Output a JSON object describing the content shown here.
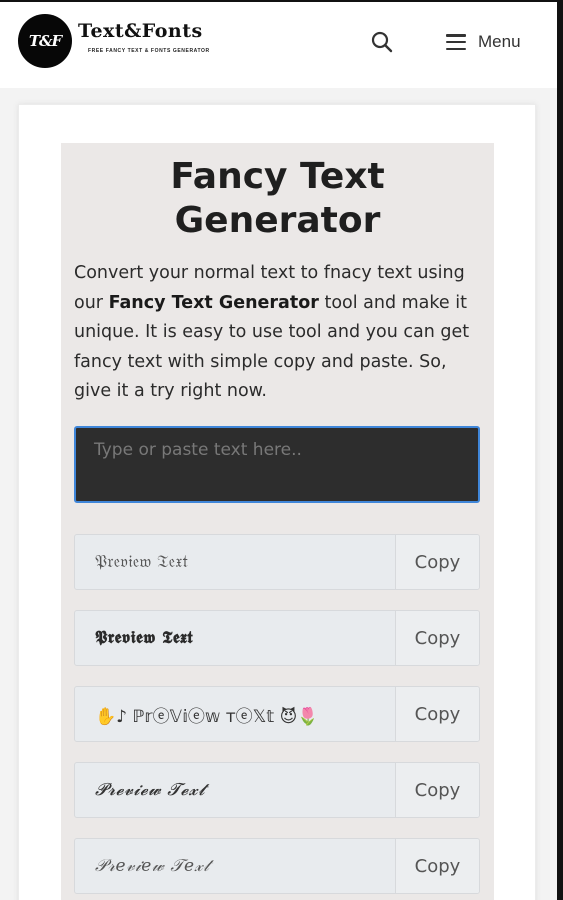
{
  "header": {
    "logo_text": "T&F",
    "brand_title": "Text&Fonts",
    "brand_tagline": "FREE FANCY TEXT & FONTS GENERATOR",
    "search_icon": "search-icon",
    "menu_icon": "hamburger-menu-icon",
    "menu_label": "Menu"
  },
  "main": {
    "title_line1": "Fancy Text",
    "title_line2": "Generator",
    "description": {
      "before": "Convert your normal text to fnacy text using our ",
      "bold": "Fancy Text Generator",
      "after": " tool and make it unique. It is easy to use tool and you can get fancy text with simple copy and paste. So, give it a try right now."
    },
    "input": {
      "placeholder": "Type or paste text here..",
      "value": ""
    },
    "results": [
      {
        "preview": "𝔓𝔯𝔢𝔳𝔦𝔢𝔴 𝔗𝔢𝔵𝔱",
        "copy_label": "Copy"
      },
      {
        "preview": "𝕻𝖗𝖊𝖛𝖎𝖊𝖜 𝕿𝖊𝖝𝖙",
        "copy_label": "Copy"
      },
      {
        "preview": "✋♪ ℙ𝕣ⓔ𝕍𝕚ⓔ𝕨 тⓔ𝕏𝕥 😈🌷",
        "copy_label": "Copy"
      },
      {
        "preview": "𝓟𝓻𝓮𝓿𝓲𝓮𝔀 𝓣𝓮𝔁𝓽",
        "copy_label": "Copy"
      },
      {
        "preview": "𝒫𝓇𝑒𝓋𝒾𝑒𝓌 𝒯𝑒𝓍𝓉",
        "copy_label": "Copy"
      }
    ]
  },
  "colors": {
    "input_bg": "#2d2d2d",
    "input_border": "#3f86d9",
    "content_bg": "#ebe8e7",
    "row_bg": "#e8ebee"
  }
}
